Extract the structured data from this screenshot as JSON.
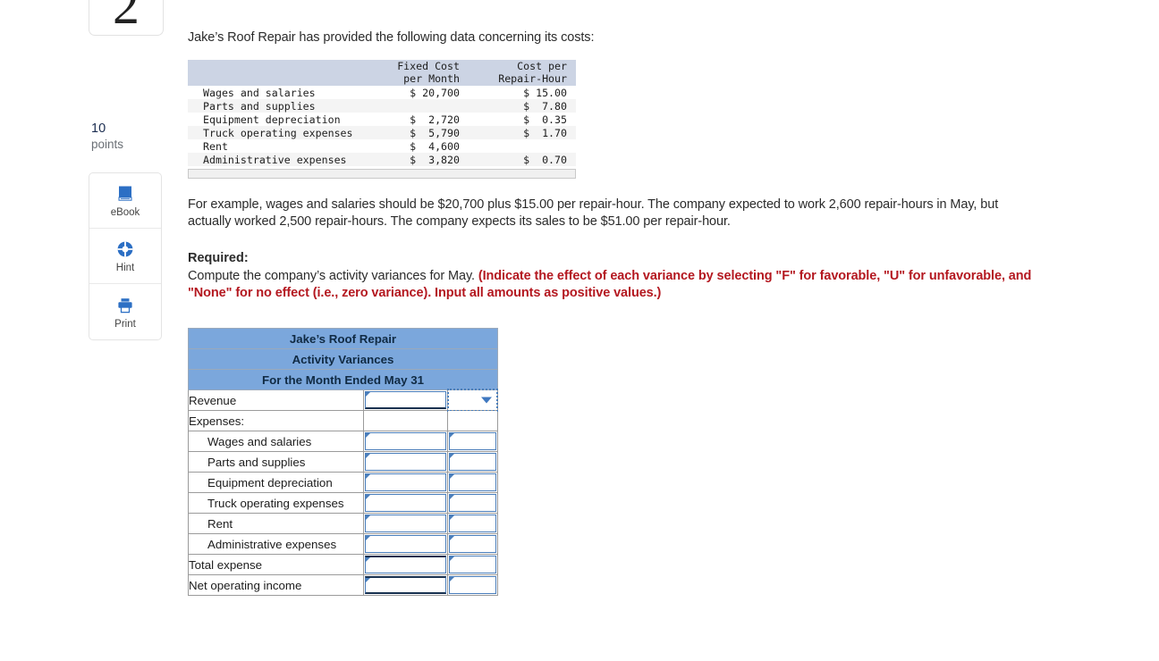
{
  "question": {
    "number": "2",
    "points_value": "10",
    "points_label": "points"
  },
  "tools": [
    {
      "label": "eBook",
      "icon": "book-icon"
    },
    {
      "label": "Hint",
      "icon": "life-ring-icon"
    },
    {
      "label": "Print",
      "icon": "printer-icon"
    }
  ],
  "body": {
    "lead": "Jake’s Roof Repair has provided the following data concerning its costs:",
    "example_paragraph": "For example, wages and salaries should be $20,700 plus $15.00 per repair-hour. The company expected to work 2,600 repair-hours in May, but actually worked 2,500 repair-hours. The company expects its sales to be $51.00 per repair-hour.",
    "required_heading": "Required:",
    "required_text_plain": "Compute the company’s activity variances for May. ",
    "required_text_emphasis": "(Indicate the effect of each variance by selecting \"F\" for favorable, \"U\" for unfavorable, and \"None\" for no effect (i.e., zero variance). Input all amounts as positive values.)"
  },
  "cost_table": {
    "headers": [
      "",
      "Fixed Cost\nper Month",
      "Cost per\nRepair-Hour"
    ],
    "rows": [
      {
        "label": "Wages and salaries",
        "fixed": "$ 20,700",
        "per_hour": "$ 15.00"
      },
      {
        "label": "Parts and supplies",
        "fixed": "",
        "per_hour": "$  7.80"
      },
      {
        "label": "Equipment depreciation",
        "fixed": "$  2,720",
        "per_hour": "$  0.35"
      },
      {
        "label": "Truck operating expenses",
        "fixed": "$  5,790",
        "per_hour": "$  1.70"
      },
      {
        "label": "Rent",
        "fixed": "$  4,600",
        "per_hour": ""
      },
      {
        "label": "Administrative expenses",
        "fixed": "$  3,820",
        "per_hour": "$  0.70"
      }
    ]
  },
  "answer_table": {
    "title_lines": [
      "Jake’s Roof Repair",
      "Activity Variances",
      "For the Month Ended May 31"
    ],
    "rows": [
      {
        "label": "Revenue",
        "indent": false,
        "amount_value": "",
        "effect_value": "",
        "has_input": true,
        "has_effect_input": false,
        "has_dropdown": true,
        "selected": true
      },
      {
        "label": "Expenses:",
        "indent": false,
        "amount_value": "",
        "effect_value": "",
        "has_input": false,
        "has_effect_input": false,
        "has_dropdown": false,
        "selected": false
      },
      {
        "label": "Wages and salaries",
        "indent": true,
        "amount_value": "",
        "effect_value": "",
        "has_input": true,
        "has_effect_input": true,
        "has_dropdown": false,
        "selected": false
      },
      {
        "label": "Parts and supplies",
        "indent": true,
        "amount_value": "",
        "effect_value": "",
        "has_input": true,
        "has_effect_input": true,
        "has_dropdown": false,
        "selected": false
      },
      {
        "label": "Equipment depreciation",
        "indent": true,
        "amount_value": "",
        "effect_value": "",
        "has_input": true,
        "has_effect_input": true,
        "has_dropdown": false,
        "selected": false
      },
      {
        "label": "Truck operating expenses",
        "indent": true,
        "amount_value": "",
        "effect_value": "",
        "has_input": true,
        "has_effect_input": true,
        "has_dropdown": false,
        "selected": false
      },
      {
        "label": "Rent",
        "indent": true,
        "amount_value": "",
        "effect_value": "",
        "has_input": true,
        "has_effect_input": true,
        "has_dropdown": false,
        "selected": false
      },
      {
        "label": "Administrative expenses",
        "indent": true,
        "amount_value": "",
        "effect_value": "",
        "has_input": true,
        "has_effect_input": true,
        "has_dropdown": false,
        "selected": false
      },
      {
        "label": "Total expense",
        "indent": false,
        "amount_value": "",
        "effect_value": "",
        "has_input": true,
        "has_effect_input": true,
        "has_dropdown": false,
        "selected": false,
        "total_line": true
      },
      {
        "label": "Net operating income",
        "indent": false,
        "amount_value": "",
        "effect_value": "",
        "has_input": true,
        "has_effect_input": true,
        "has_dropdown": false,
        "selected": false,
        "double_line": true
      }
    ]
  },
  "colors": {
    "header_blue": "#7ba7dc",
    "input_border": "#4a7ebb",
    "emphasis_red": "#b41820",
    "data_header_bg": "#ccd4e4"
  }
}
